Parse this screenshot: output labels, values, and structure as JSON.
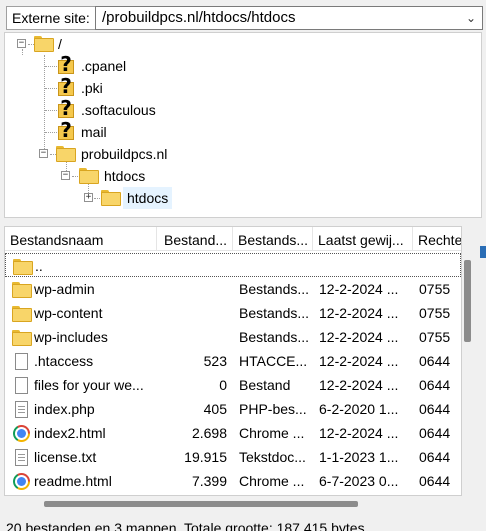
{
  "site": {
    "label": "Externe site:",
    "path": "/probuildpcs.nl/htdocs/htdocs",
    "dropdown_icon": "chevron-down-icon"
  },
  "tree": {
    "root": "/",
    "cpanel": ".cpanel",
    "pki": ".pki",
    "softaculous": ".softaculous",
    "mail": "mail",
    "domain": "probuildpcs.nl",
    "htdocs": "htdocs",
    "htdocs_sub": "htdocs"
  },
  "columns": {
    "name": "Bestandsnaam",
    "size": "Bestand...",
    "type": "Bestands...",
    "modified": "Laatst gewij...",
    "perms": "Rechte"
  },
  "files": [
    {
      "name": "..",
      "size": "",
      "type": "",
      "modified": "",
      "perms": "",
      "icon": "folder-icon"
    },
    {
      "name": "wp-admin",
      "size": "",
      "type": "Bestands...",
      "modified": "12-2-2024 ...",
      "perms": "0755",
      "icon": "folder-icon"
    },
    {
      "name": "wp-content",
      "size": "",
      "type": "Bestands...",
      "modified": "12-2-2024 ...",
      "perms": "0755",
      "icon": "folder-icon"
    },
    {
      "name": "wp-includes",
      "size": "",
      "type": "Bestands...",
      "modified": "12-2-2024 ...",
      "perms": "0755",
      "icon": "folder-icon"
    },
    {
      "name": ".htaccess",
      "size": "523",
      "type": "HTACCE...",
      "modified": "12-2-2024 ...",
      "perms": "0644",
      "icon": "file-icon"
    },
    {
      "name": "files for your we...",
      "size": "0",
      "type": "Bestand",
      "modified": "12-2-2024 ...",
      "perms": "0644",
      "icon": "file-icon"
    },
    {
      "name": "index.php",
      "size": "405",
      "type": "PHP-bes...",
      "modified": "6-2-2020 1...",
      "perms": "0644",
      "icon": "text-file-icon"
    },
    {
      "name": "index2.html",
      "size": "2.698",
      "type": "Chrome ...",
      "modified": "12-2-2024 ...",
      "perms": "0644",
      "icon": "chrome-icon"
    },
    {
      "name": "license.txt",
      "size": "19.915",
      "type": "Tekstdoc...",
      "modified": "1-1-2023 1...",
      "perms": "0644",
      "icon": "text-file-icon"
    },
    {
      "name": "readme.html",
      "size": "7.399",
      "type": "Chrome ...",
      "modified": "6-7-2023 0...",
      "perms": "0644",
      "icon": "chrome-icon"
    }
  ],
  "status": "20 bestanden en 3 mappen. Totale grootte: 187.415 bytes"
}
